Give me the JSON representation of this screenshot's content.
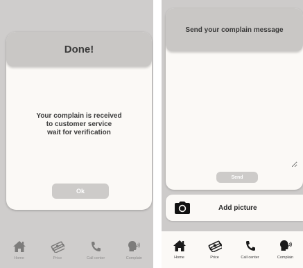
{
  "left_screen": {
    "dialog": {
      "title": "Done!",
      "message_lines": [
        "Your complain is received",
        "to customer service",
        "wait for verification"
      ],
      "ok_label": "Ok"
    }
  },
  "right_screen": {
    "complain": {
      "title": "Send your complain message",
      "message_value": "",
      "send_label": "Send"
    },
    "add_picture": {
      "label": "Add picture",
      "icon": "camera-icon"
    }
  },
  "nav": {
    "items": [
      {
        "label": "Home",
        "icon": "home-icon"
      },
      {
        "label": "Price",
        "icon": "money-icon"
      },
      {
        "label": "Call center",
        "icon": "phone-icon"
      },
      {
        "label": "Complain",
        "icon": "speaking-head-icon"
      }
    ]
  },
  "colors": {
    "overlay_bg": "#cfcdcc",
    "card_bg": "#fbf9f6",
    "header_bg": "#c9c7c5",
    "button_bg": "#cdcbc9",
    "icon_color": "#1b1b1b"
  }
}
